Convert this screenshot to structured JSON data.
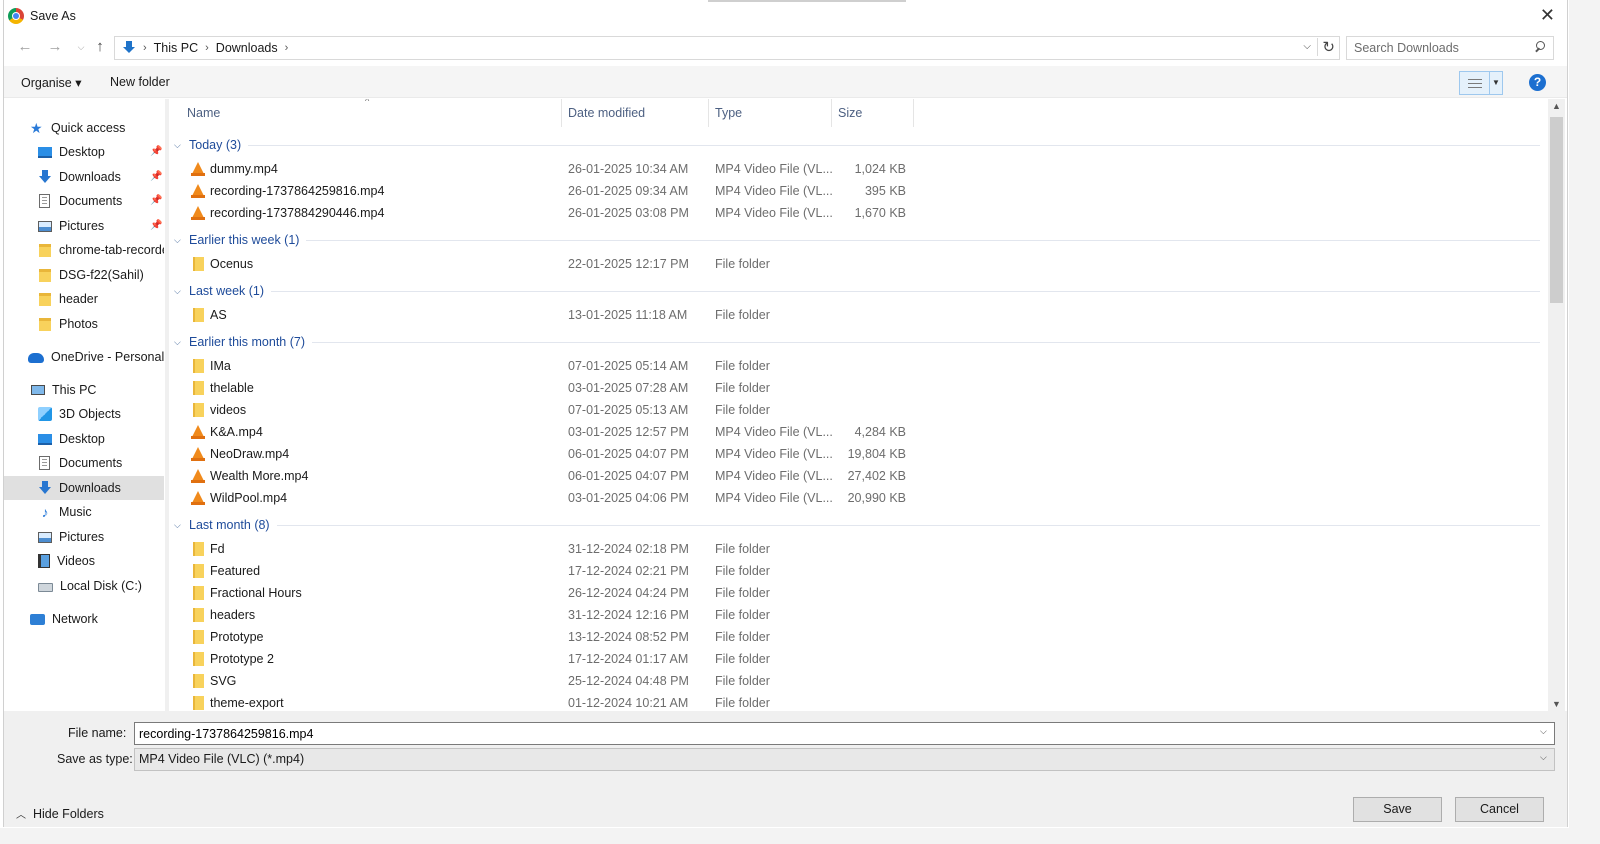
{
  "window": {
    "title": "Save As"
  },
  "address": {
    "crumbs": [
      "This PC",
      "Downloads"
    ],
    "search_placeholder": "Search Downloads"
  },
  "toolbar": {
    "organise_label": "Organise ▾",
    "new_folder_label": "New folder",
    "help_label": "?"
  },
  "nav": {
    "quick_access": "Quick access",
    "qa_items": [
      "Desktop",
      "Downloads",
      "Documents",
      "Pictures",
      "chrome-tab-recorde",
      "DSG-f22(Sahil)",
      "header",
      "Photos"
    ],
    "onedrive": "OneDrive - Personal",
    "this_pc": "This PC",
    "pc_items": [
      "3D Objects",
      "Desktop",
      "Documents",
      "Downloads",
      "Music",
      "Pictures",
      "Videos",
      "Local Disk (C:)"
    ],
    "network": "Network"
  },
  "columns": {
    "name": "Name",
    "date": "Date modified",
    "type": "Type",
    "size": "Size"
  },
  "groups": [
    {
      "label": "Today (3)",
      "rows": [
        {
          "name": "dummy.mp4",
          "date": "26-01-2025 10:34 AM",
          "type": "MP4 Video File (VL...",
          "size": "1,024 KB",
          "kind": "vlc"
        },
        {
          "name": "recording-1737864259816.mp4",
          "date": "26-01-2025 09:34 AM",
          "type": "MP4 Video File (VL...",
          "size": "395 KB",
          "kind": "vlc"
        },
        {
          "name": "recording-1737884290446.mp4",
          "date": "26-01-2025 03:08 PM",
          "type": "MP4 Video File (VL...",
          "size": "1,670 KB",
          "kind": "vlc"
        }
      ]
    },
    {
      "label": "Earlier this week (1)",
      "rows": [
        {
          "name": "Ocenus",
          "date": "22-01-2025 12:17 PM",
          "type": "File folder",
          "size": "",
          "kind": "folder"
        }
      ]
    },
    {
      "label": "Last week (1)",
      "rows": [
        {
          "name": "AS",
          "date": "13-01-2025 11:18 AM",
          "type": "File folder",
          "size": "",
          "kind": "folder"
        }
      ]
    },
    {
      "label": "Earlier this month (7)",
      "rows": [
        {
          "name": "IMa",
          "date": "07-01-2025 05:14 AM",
          "type": "File folder",
          "size": "",
          "kind": "folder"
        },
        {
          "name": "thelable",
          "date": "03-01-2025 07:28 AM",
          "type": "File folder",
          "size": "",
          "kind": "folder"
        },
        {
          "name": "videos",
          "date": "07-01-2025 05:13 AM",
          "type": "File folder",
          "size": "",
          "kind": "folder"
        },
        {
          "name": "K&A.mp4",
          "date": "03-01-2025 12:57 PM",
          "type": "MP4 Video File (VL...",
          "size": "4,284 KB",
          "kind": "vlc"
        },
        {
          "name": "NeoDraw.mp4",
          "date": "06-01-2025 04:07 PM",
          "type": "MP4 Video File (VL...",
          "size": "19,804 KB",
          "kind": "vlc"
        },
        {
          "name": "Wealth More.mp4",
          "date": "06-01-2025 04:07 PM",
          "type": "MP4 Video File (VL...",
          "size": "27,402 KB",
          "kind": "vlc"
        },
        {
          "name": "WildPool.mp4",
          "date": "03-01-2025 04:06 PM",
          "type": "MP4 Video File (VL...",
          "size": "20,990 KB",
          "kind": "vlc"
        }
      ]
    },
    {
      "label": "Last month (8)",
      "rows": [
        {
          "name": "Fd",
          "date": "31-12-2024 02:18 PM",
          "type": "File folder",
          "size": "",
          "kind": "folder"
        },
        {
          "name": "Featured",
          "date": "17-12-2024 02:21 PM",
          "type": "File folder",
          "size": "",
          "kind": "folder"
        },
        {
          "name": "Fractional Hours",
          "date": "26-12-2024 04:24 PM",
          "type": "File folder",
          "size": "",
          "kind": "folder"
        },
        {
          "name": "headers",
          "date": "31-12-2024 12:16 PM",
          "type": "File folder",
          "size": "",
          "kind": "folder"
        },
        {
          "name": "Prototype",
          "date": "13-12-2024 08:52 PM",
          "type": "File folder",
          "size": "",
          "kind": "folder"
        },
        {
          "name": "Prototype 2",
          "date": "17-12-2024 01:17 AM",
          "type": "File folder",
          "size": "",
          "kind": "folder"
        },
        {
          "name": "SVG",
          "date": "25-12-2024 04:48 PM",
          "type": "File folder",
          "size": "",
          "kind": "folder"
        },
        {
          "name": "theme-export",
          "date": "01-12-2024 10:21 AM",
          "type": "File folder",
          "size": "",
          "kind": "folder"
        }
      ]
    }
  ],
  "bottom": {
    "file_name_label": "File name:",
    "file_name_value": "recording-1737864259816.mp4",
    "save_type_label": "Save as type:",
    "save_type_value": "MP4 Video File (VLC) (*.mp4)",
    "hide_folders_label": "Hide Folders",
    "save_label": "Save",
    "cancel_label": "Cancel"
  }
}
